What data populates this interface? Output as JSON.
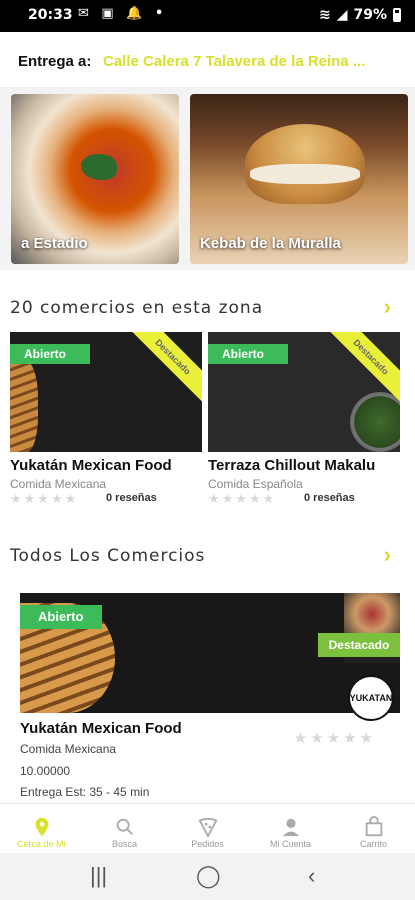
{
  "status": {
    "time": "20:33",
    "battery": "79%"
  },
  "delivery": {
    "label": "Entrega a:",
    "address": "Calle Calera 7 Talavera de la Reina ..."
  },
  "featured": [
    {
      "title": "a Estadio"
    },
    {
      "title": "Kebab de la Muralla"
    }
  ],
  "zone": {
    "title": "20 comercios en esta zona",
    "stores": [
      {
        "badge": "Abierto",
        "ribbon": "Destacado",
        "name": "Yukatán Mexican Food",
        "category": "Comida Mexicana",
        "rating": 0,
        "reviews": "0 reseñas"
      },
      {
        "badge": "Abierto",
        "ribbon": "Destacado",
        "name": "Terraza Chillout Makalu",
        "category": "Comida Española",
        "rating": 0,
        "reviews": "0 reseñas"
      }
    ]
  },
  "all": {
    "title": "Todos Los Comercios",
    "store": {
      "badge": "Abierto",
      "featured_badge": "Destacado",
      "logo_text": "YUKATAN",
      "name": "Yukatán Mexican Food",
      "category": "Comida Mexicana",
      "price": "10.00000",
      "eta": "Entrega Est: 35 - 45 min",
      "rating": 0
    }
  },
  "tabs": [
    {
      "label": "Cerca de Mí",
      "icon": "location-pin-icon",
      "active": true
    },
    {
      "label": "Busca",
      "icon": "search-icon",
      "active": false
    },
    {
      "label": "Pedidos",
      "icon": "pizza-slice-icon",
      "active": false
    },
    {
      "label": "Mi Cuenta",
      "icon": "user-icon",
      "active": false
    },
    {
      "label": "Carrito",
      "icon": "shopping-bag-icon",
      "active": false
    }
  ],
  "colors": {
    "accent": "#d7e02a",
    "open_badge": "#3dba5a",
    "featured_badge": "#7cc13e"
  }
}
